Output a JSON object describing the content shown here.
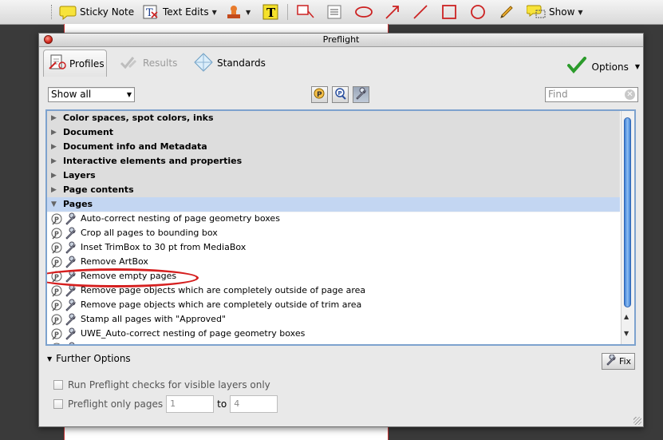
{
  "toolbar": {
    "sticky_note": "Sticky Note",
    "text_edits": "Text Edits",
    "show": "Show"
  },
  "dialog": {
    "title": "Preflight",
    "tabs": [
      "Profiles",
      "Results",
      "Standards"
    ],
    "options": "Options",
    "filter": "Show all",
    "find_placeholder": "Find",
    "categories": [
      "Color spaces, spot colors, inks",
      "Document",
      "Document info and Metadata",
      "Interactive elements and properties",
      "Layers",
      "Page contents",
      "Pages"
    ],
    "page_fixups": [
      "Auto-correct nesting of page geometry boxes",
      "Crop all pages to bounding box",
      "Inset TrimBox to 30 pt from MediaBox",
      "Remove ArtBox",
      "Remove empty pages",
      "Remove page objects which are completely outside of page area",
      "Remove page objects which are completely outside of trim area",
      "Stamp all pages with \"Approved\"",
      "UWE_Auto-correct nesting of page geometry boxes"
    ],
    "further_options": "Further Options",
    "fix": "Fix",
    "opt_visible_layers": "Run Preflight checks for visible layers only",
    "opt_only_pages": "Preflight only pages",
    "page_from": "1",
    "to": "to",
    "page_to": "4"
  },
  "colors": {
    "accent": "#3d7fd6",
    "selected_category": "#c3d6f2",
    "annotation": "#d51f1f"
  }
}
